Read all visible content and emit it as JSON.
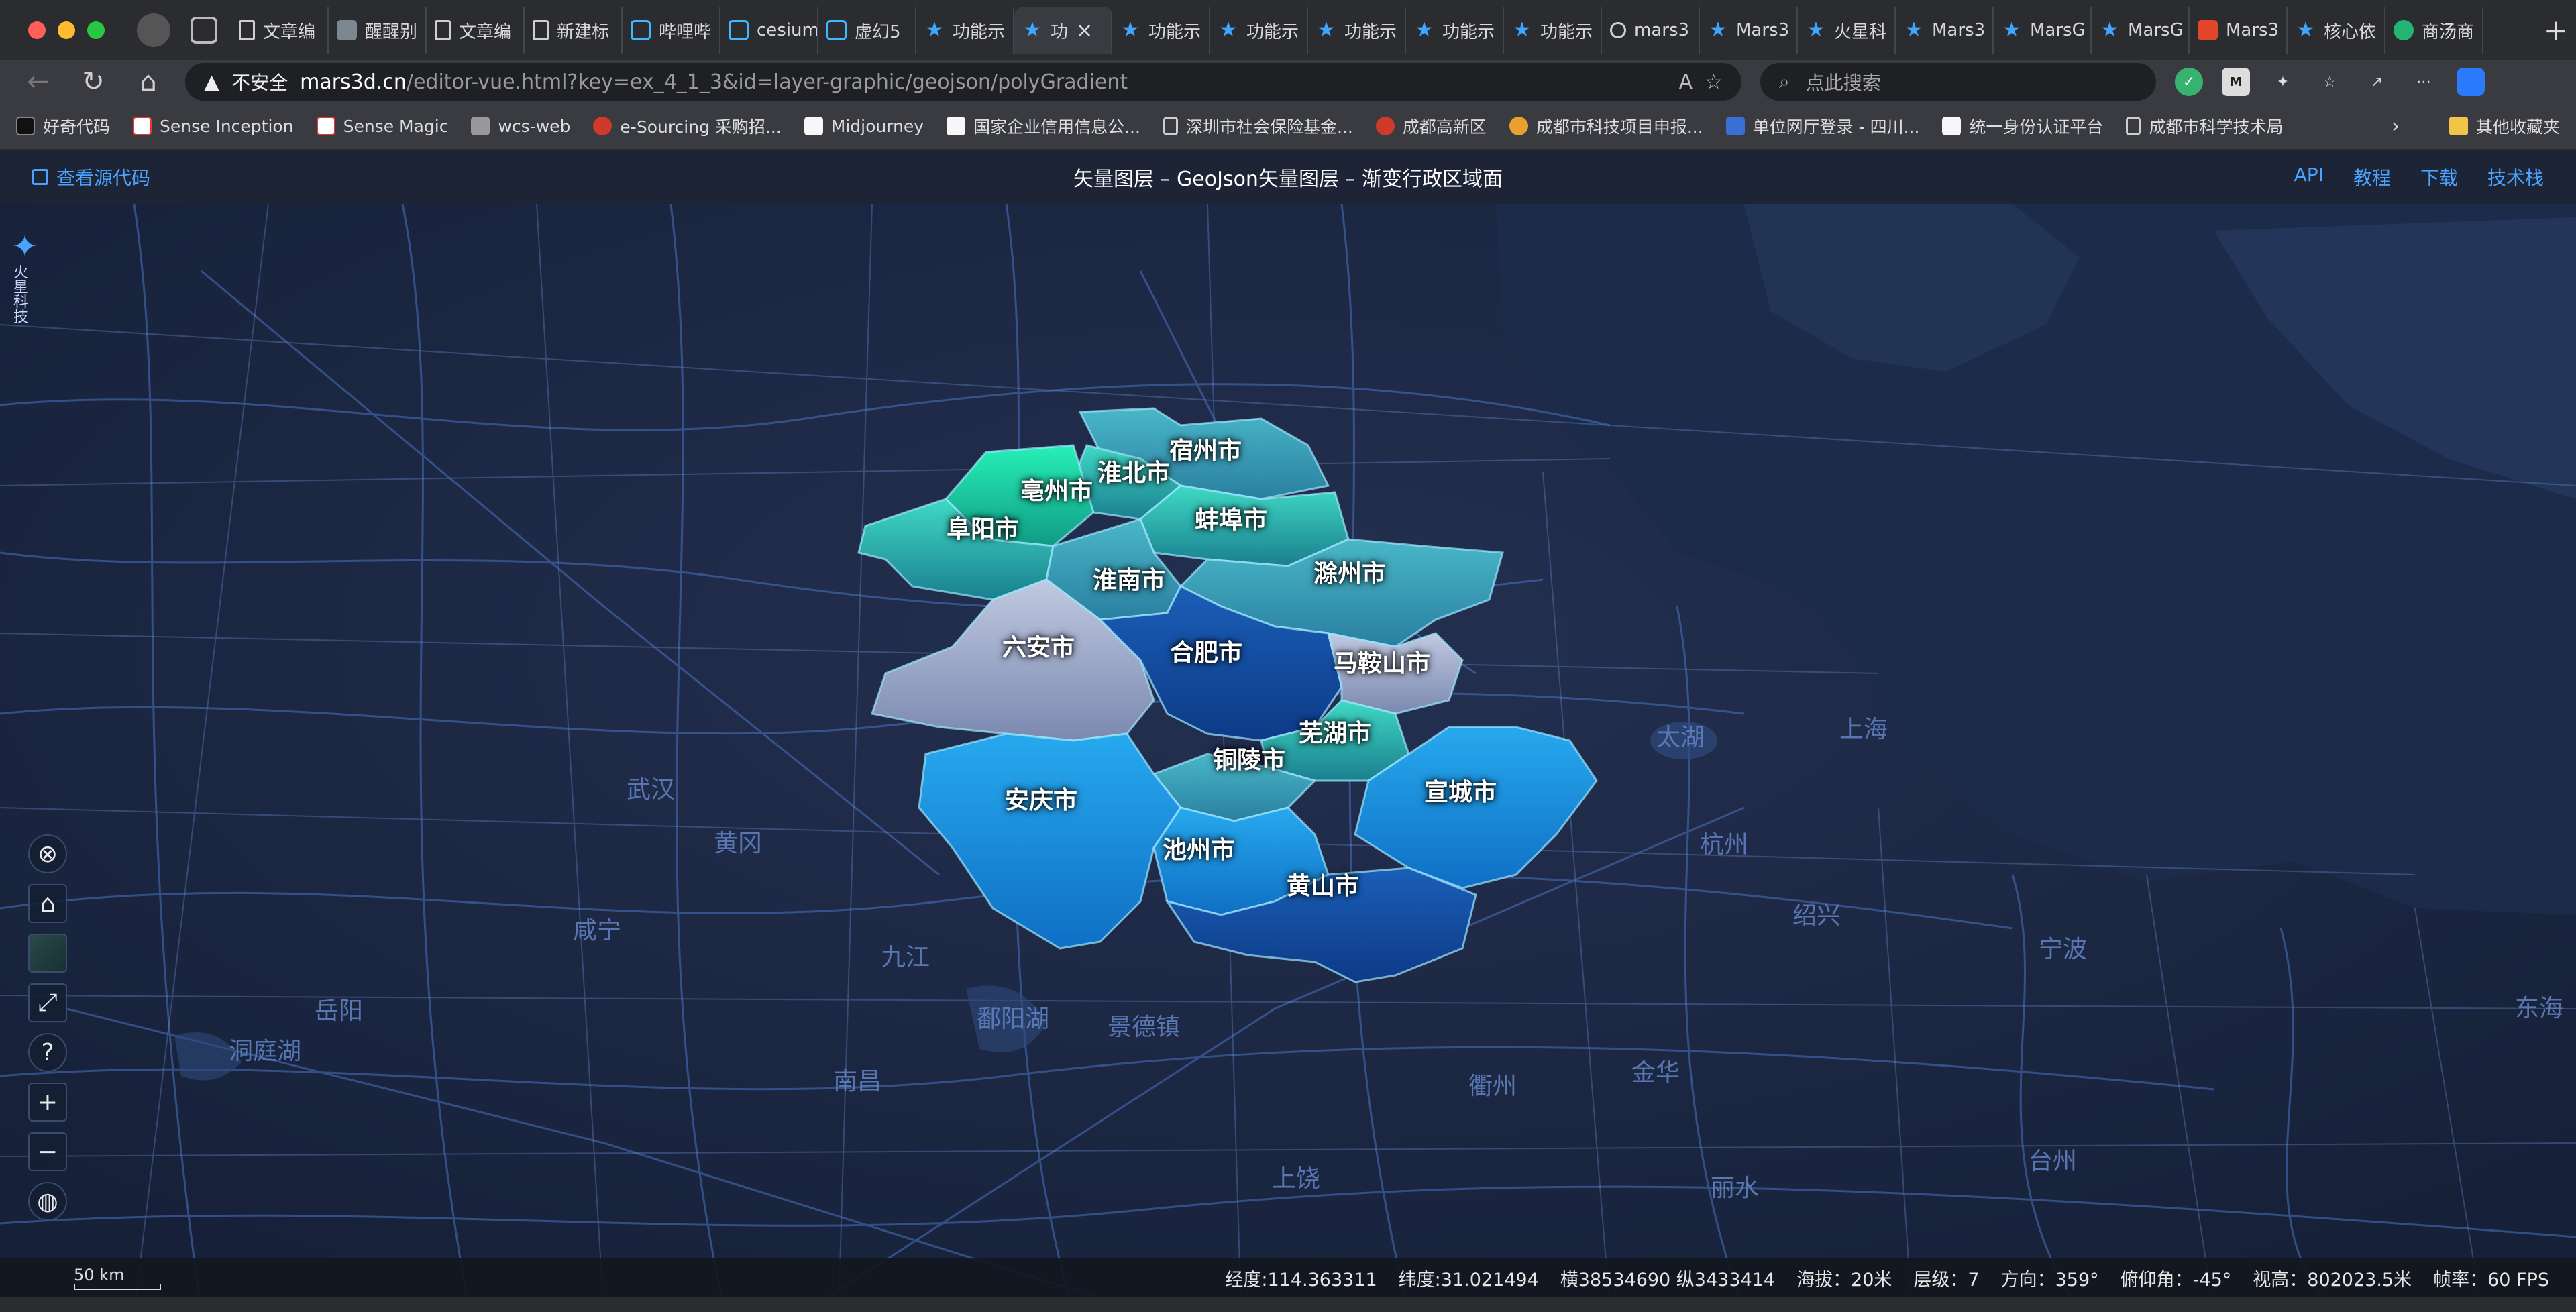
{
  "tabs": [
    {
      "label": "文章编",
      "icon": "doc"
    },
    {
      "label": "醒醒别",
      "icon": "img"
    },
    {
      "label": "文章编",
      "icon": "doc"
    },
    {
      "label": "新建标",
      "icon": "doc"
    },
    {
      "label": "哔哩哔",
      "icon": "tv"
    },
    {
      "label": "cesium",
      "icon": "tv"
    },
    {
      "label": "虚幻5",
      "icon": "tv"
    },
    {
      "label": "功能示",
      "icon": "star"
    },
    {
      "label": "功",
      "icon": "star",
      "active": true
    },
    {
      "label": "功能示",
      "icon": "star"
    },
    {
      "label": "功能示",
      "icon": "star"
    },
    {
      "label": "功能示",
      "icon": "star"
    },
    {
      "label": "功能示",
      "icon": "star"
    },
    {
      "label": "功能示",
      "icon": "star"
    },
    {
      "label": "mars3",
      "icon": "search"
    },
    {
      "label": "Mars3",
      "icon": "star"
    },
    {
      "label": "火星科",
      "icon": "star"
    },
    {
      "label": "Mars3",
      "icon": "star"
    },
    {
      "label": "MarsG",
      "icon": "star"
    },
    {
      "label": "MarsG",
      "icon": "star"
    },
    {
      "label": "Mars3",
      "icon": "red"
    },
    {
      "label": "核心依",
      "icon": "star"
    },
    {
      "label": "商汤商",
      "icon": "green"
    }
  ],
  "address": {
    "insecure_label": "不安全",
    "url_host": "mars3d.cn",
    "url_path": "/editor-vue.html?key=ex_4_1_3&id=layer-graphic/geojson/polyGradient",
    "search_placeholder": "点此搜索"
  },
  "bookmarks": [
    {
      "label": "好奇代码",
      "icon": "c1"
    },
    {
      "label": "Sense Inception",
      "icon": "c2"
    },
    {
      "label": "Sense Magic",
      "icon": "c2"
    },
    {
      "label": "wcs-web",
      "icon": "c3"
    },
    {
      "label": "e-Sourcing 采购招...",
      "icon": "c4"
    },
    {
      "label": "Midjourney",
      "icon": "c5"
    },
    {
      "label": "国家企业信用信息公...",
      "icon": "c5"
    },
    {
      "label": "深圳市社会保险基金...",
      "icon": "doc"
    },
    {
      "label": "成都高新区",
      "icon": "c4"
    },
    {
      "label": "成都市科技项目申报...",
      "icon": "c6"
    },
    {
      "label": "单位网厅登录 - 四川...",
      "icon": "c7"
    },
    {
      "label": "统一身份认证平台",
      "icon": "c5"
    },
    {
      "label": "成都市科学技术局",
      "icon": "doc"
    }
  ],
  "bookmarks_other": "其他收藏夹",
  "app": {
    "view_source": "查看源代码",
    "title": "矢量图层 – GeoJson矢量图层 – 渐变行政区域面",
    "links": [
      "API",
      "教程",
      "下载",
      "技术栈"
    ]
  },
  "map": {
    "logo_text": "火星科技",
    "region_labels": [
      {
        "name": "宿州市"
      },
      {
        "name": "淮北市"
      },
      {
        "name": "亳州市"
      },
      {
        "name": "阜阳市"
      },
      {
        "name": "蚌埠市"
      },
      {
        "name": "淮南市"
      },
      {
        "name": "滁州市"
      },
      {
        "name": "六安市"
      },
      {
        "name": "合肥市"
      },
      {
        "name": "马鞍山市"
      },
      {
        "name": "芜湖市"
      },
      {
        "name": "铜陵市"
      },
      {
        "name": "宣城市"
      },
      {
        "name": "安庆市"
      },
      {
        "name": "池州市"
      },
      {
        "name": "黄山市"
      }
    ],
    "base_labels": [
      {
        "name": "武汉"
      },
      {
        "name": "黄冈"
      },
      {
        "name": "咸宁"
      },
      {
        "name": "九江"
      },
      {
        "name": "岳阳"
      },
      {
        "name": "洞庭湖"
      },
      {
        "name": "鄱阳湖"
      },
      {
        "name": "景德镇"
      },
      {
        "name": "南昌"
      },
      {
        "name": "衢州"
      },
      {
        "name": "金华"
      },
      {
        "name": "丽水"
      },
      {
        "name": "台州"
      },
      {
        "name": "绍兴"
      },
      {
        "name": "杭州"
      },
      {
        "name": "宁波"
      },
      {
        "name": "上饶"
      },
      {
        "name": "太湖"
      },
      {
        "name": "上海"
      },
      {
        "name": "东海"
      }
    ]
  },
  "status": {
    "scale": "50 km",
    "lon": "经度:114.363311",
    "lat": "纬度:31.021494",
    "xy": "横38534690 纵3433414",
    "alt": "海拔：20米",
    "level": "层级：7",
    "heading": "方向：359°",
    "pitch": "俯仰角：-45°",
    "view_height": "视高：802023.5米",
    "fps": "帧率：60 FPS"
  },
  "colors": {
    "accent": "#4aa3ff",
    "map_bg": "#15203a",
    "ocean": "#1b2a47"
  }
}
